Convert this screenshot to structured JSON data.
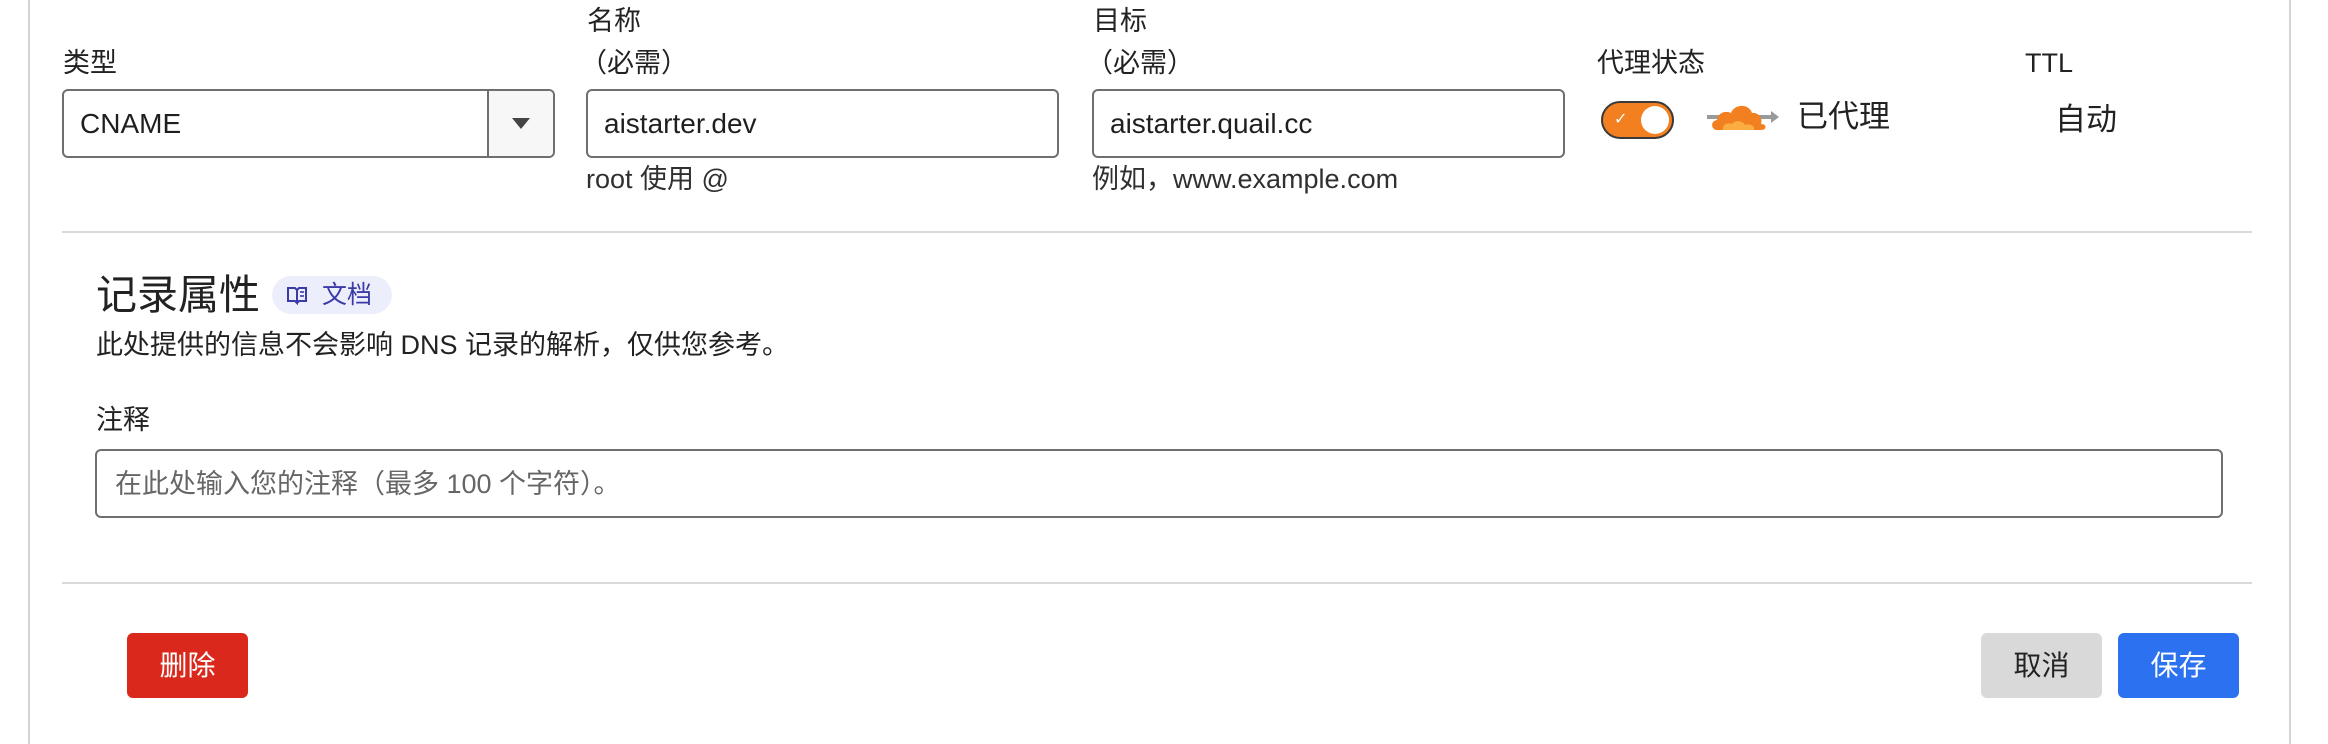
{
  "form": {
    "type": {
      "label": "类型",
      "value": "CNAME"
    },
    "name": {
      "label_line1": "名称",
      "label_line2": "（必需）",
      "value": "aistarter.dev",
      "help": "root 使用 @"
    },
    "target": {
      "label_line1": "目标",
      "label_line2": "（必需）",
      "value": "aistarter.quail.cc",
      "help": "例如，www.example.com"
    },
    "proxy": {
      "label": "代理状态",
      "enabled": true,
      "status_text": "已代理",
      "icon": "cloud-icon"
    },
    "ttl": {
      "label": "TTL",
      "value": "自动"
    }
  },
  "record_attributes": {
    "title": "记录属性",
    "doc_badge": "文档",
    "description": "此处提供的信息不会影响 DNS 记录的解析，仅供您参考。",
    "comment_label": "注释",
    "comment_placeholder": "在此处输入您的注释（最多 100 个字符）。"
  },
  "actions": {
    "delete": "删除",
    "cancel": "取消",
    "save": "保存"
  },
  "colors": {
    "proxy_orange": "#f38020",
    "delete_red": "#da291c",
    "save_blue": "#2c72f0",
    "cancel_gray": "#d9d9d9",
    "doc_badge_bg": "#edeefc"
  }
}
